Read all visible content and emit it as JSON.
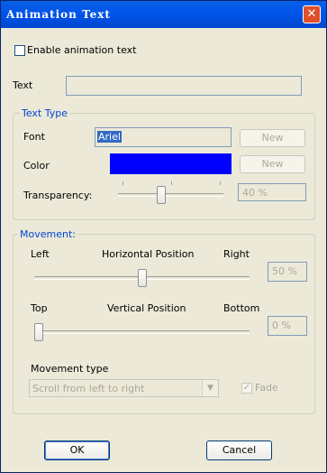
{
  "window": {
    "title": "Animation Text"
  },
  "enable_checkbox": {
    "label": "Enable animation text"
  },
  "text_field": {
    "label": "Text",
    "value": ""
  },
  "text_type": {
    "legend": "Text Type",
    "font": {
      "label": "Font",
      "value": "Ariel",
      "button": "New"
    },
    "color": {
      "label": "Color",
      "swatch": "#0000ff",
      "button": "New"
    },
    "transparency": {
      "label": "Transparency:",
      "value": "40 %",
      "level_percent": 40
    }
  },
  "movement": {
    "legend": "Movement:",
    "horizontal": {
      "left": "Left",
      "center": "Horizontal Position",
      "right": "Right",
      "value": "50 %",
      "level_percent": 50
    },
    "vertical": {
      "left": "Top",
      "center": "Vertical Position",
      "right": "Bottom",
      "value": "0 %",
      "level_percent": 0
    },
    "type": {
      "label": "Movement type",
      "selected": "Scroll from left to right"
    },
    "fade": {
      "label": "Fade",
      "checked": true
    }
  },
  "buttons": {
    "ok": "OK",
    "cancel": "Cancel"
  }
}
